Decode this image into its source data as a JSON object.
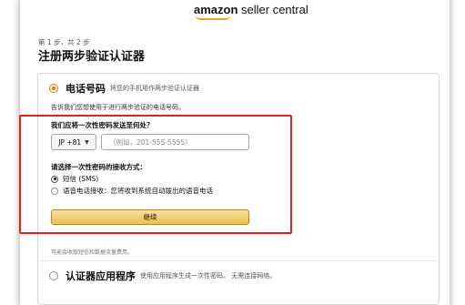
{
  "logo": {
    "brand": "amazon",
    "product": " seller central"
  },
  "step": "第 1 步，共 2 步",
  "title": "注册两步验证认证器",
  "phone_option": {
    "title": "电话号码",
    "desc": "将您的手机用作两步验证认证器",
    "explain": "告诉我们您想使用于进行两步验证的电话号码。"
  },
  "send_question": "我们应将一次性密码发送至何处？",
  "country_code": "JP +81",
  "phone_placeholder": "（例如，201-555-5555）",
  "receive_question": "请选择一次性密码的接收方式：",
  "methods": [
    {
      "label": "短信 (SMS)",
      "selected": true
    },
    {
      "label": "语音电话接收：您将收到系统自动拨出的语音电话",
      "selected": false
    }
  ],
  "continue_label": "继续",
  "note": "可能会收取短信和数据流量费用。",
  "app_option": {
    "title": "认证器应用程序",
    "desc": "使用应用程序生成一次性密码。  无需连接网络。"
  },
  "colors": {
    "accent": "#e77600",
    "highlight": "#e8201a",
    "button": "#f0c14b"
  }
}
